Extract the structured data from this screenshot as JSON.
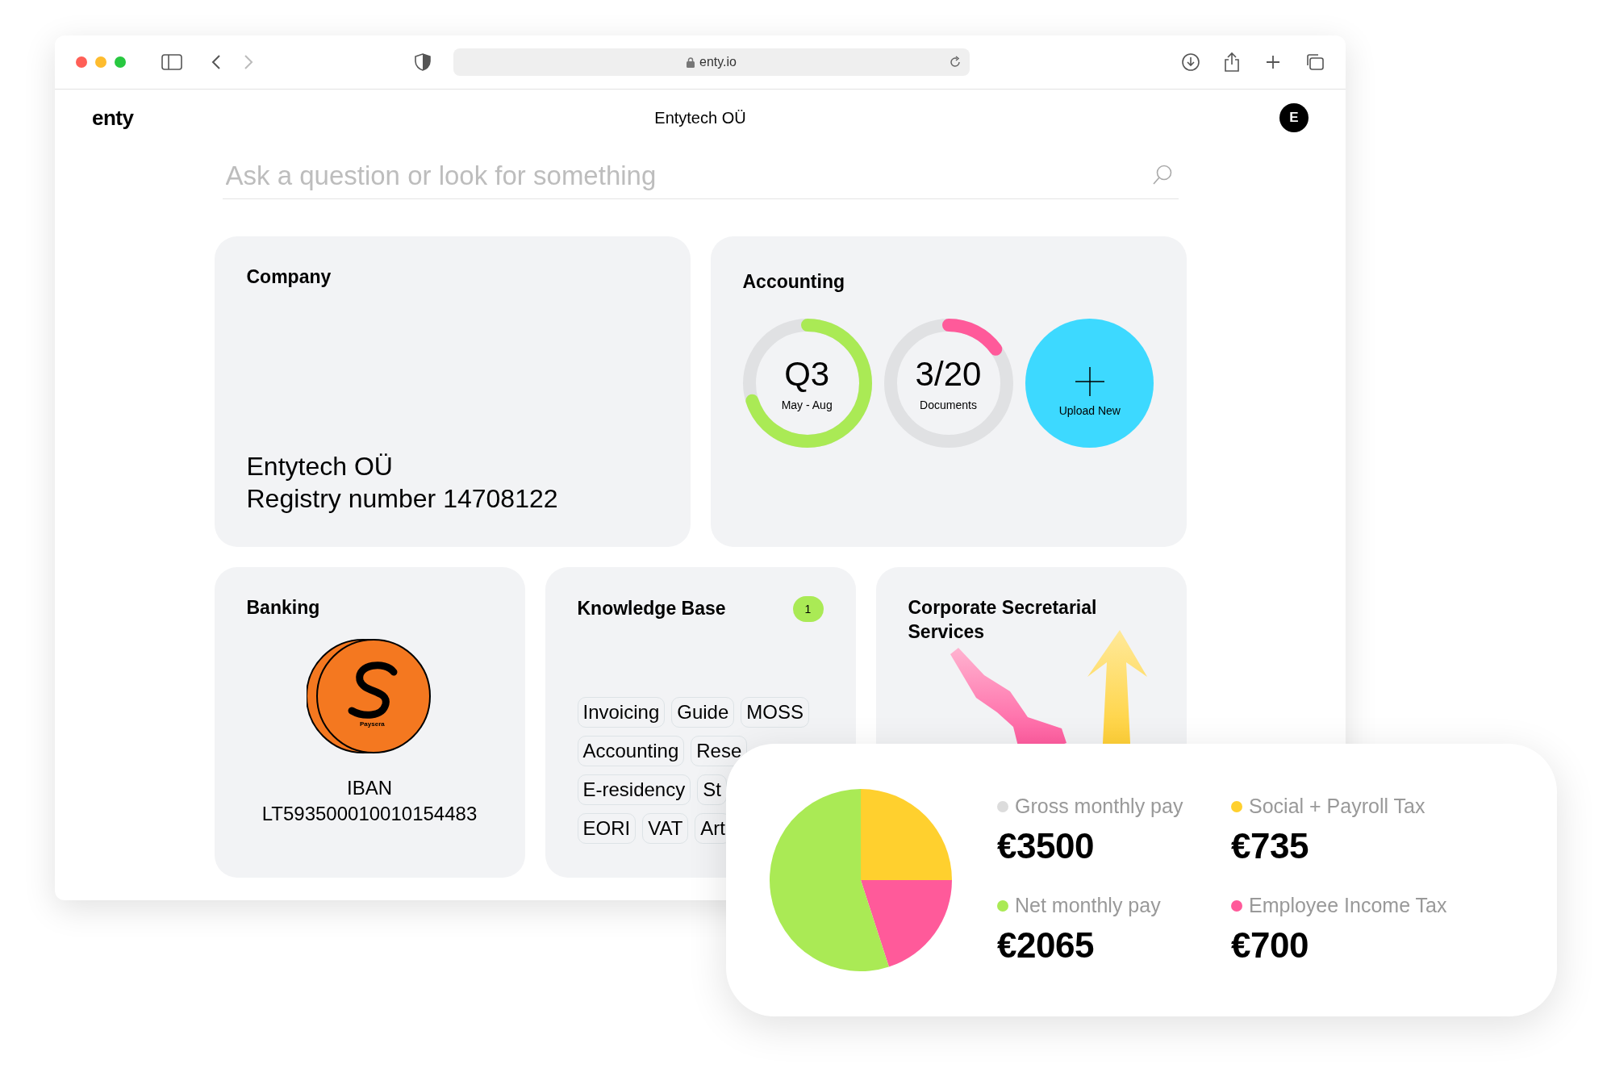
{
  "browser": {
    "url": "enty.io"
  },
  "header": {
    "logo": "enty",
    "title": "Entytech OÜ",
    "avatar": "E"
  },
  "search": {
    "placeholder": "Ask a question or look for something"
  },
  "company": {
    "title": "Company",
    "name": "Entytech OÜ",
    "registry": "Registry number 14708122"
  },
  "accounting": {
    "title": "Accounting",
    "rings": [
      {
        "value": "Q3",
        "caption": "May - Aug",
        "level": 0.7,
        "color": "#aaea55"
      },
      {
        "value": "3/20",
        "caption": "Documents",
        "level": 0.15,
        "color": "#ff5a9a"
      }
    ],
    "upload": {
      "label": "Upload New"
    }
  },
  "banking": {
    "title": "Banking",
    "bank_logo_text": "Paysera",
    "iban_label": "IBAN",
    "iban": "LT593500010010154483"
  },
  "knowledge_base": {
    "title": "Knowledge Base",
    "badge": "1",
    "tag_rows": [
      [
        "Invoicing",
        "Guide",
        "MOSS"
      ],
      [
        "Accounting",
        "Rese"
      ],
      [
        "E-residency",
        "St"
      ],
      [
        "EORI",
        "VAT",
        "Art"
      ]
    ]
  },
  "corporate": {
    "title": "Corporate Secretarial Services"
  },
  "salary": {
    "chart_data": {
      "type": "pie",
      "values": [
        25,
        20,
        55
      ],
      "colors": [
        "#ffd02e",
        "#ff5a9a",
        "#aaea55"
      ]
    },
    "stats": [
      {
        "label": "Gross monthly pay",
        "value": "€3500",
        "color": "#dcdcdc"
      },
      {
        "label": "Social + Payroll Tax",
        "value": "€735",
        "color": "#ffd02e"
      },
      {
        "label": "Net monthly pay",
        "value": "€2065",
        "color": "#aaea55"
      },
      {
        "label": "Employee Income Tax",
        "value": "€700",
        "color": "#ff5a9a"
      }
    ]
  }
}
